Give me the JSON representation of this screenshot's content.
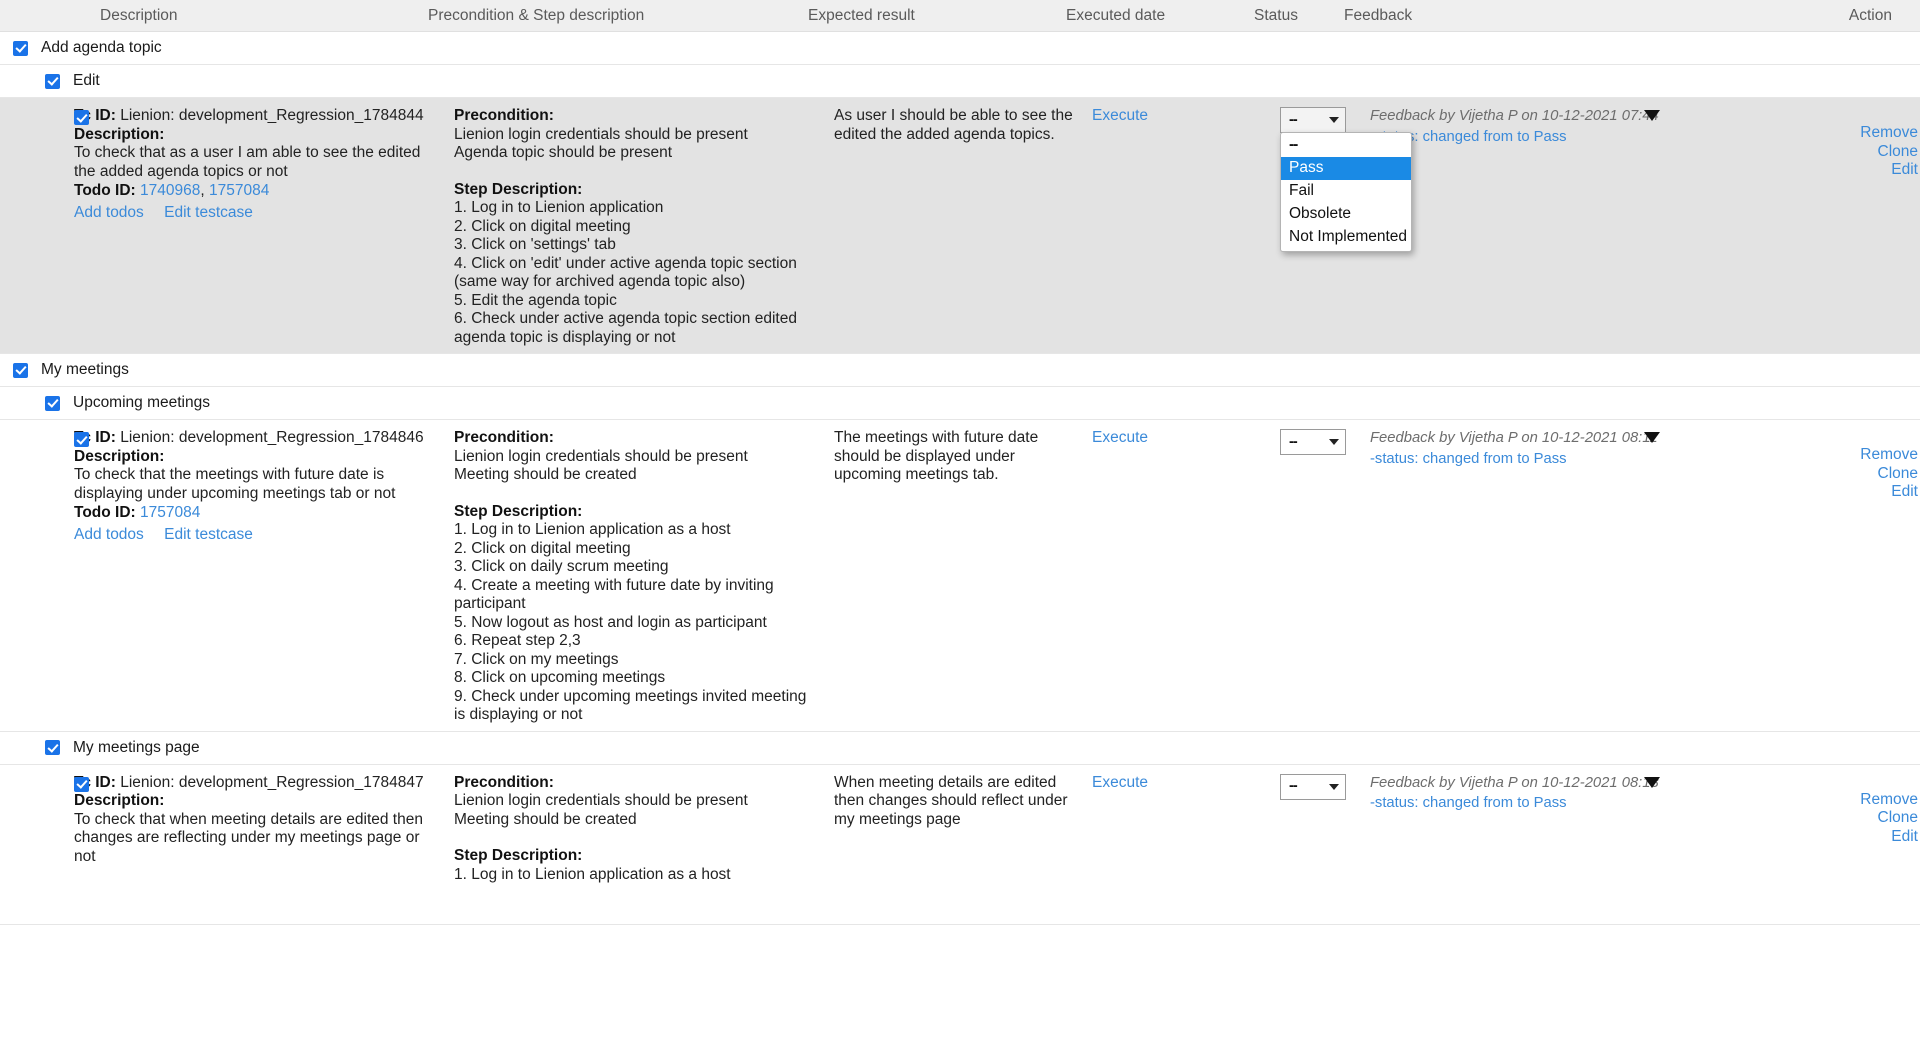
{
  "table": {
    "columns": [
      {
        "key": "checkbox",
        "label": ""
      },
      {
        "key": "description",
        "label": "Description"
      },
      {
        "key": "step",
        "label": "Precondition & Step description"
      },
      {
        "key": "expected",
        "label": "Expected result"
      },
      {
        "key": "executed",
        "label": "Executed date"
      },
      {
        "key": "status",
        "label": "Status"
      },
      {
        "key": "feedback",
        "label": "Feedback"
      },
      {
        "key": "action",
        "label": "Action"
      }
    ]
  },
  "labels": {
    "tc_id": "Tc ID:",
    "description": "Description:",
    "todo_id": "Todo ID:",
    "precondition": "Precondition:",
    "step_description": "Step Description:",
    "add_todos": "Add todos",
    "edit_testcase": "Edit testcase",
    "execute": "Execute",
    "remove": "Remove",
    "clone": "Clone",
    "edit": "Edit",
    "select_placeholder": "--"
  },
  "status_options": [
    "--",
    "Pass",
    "Fail",
    "Obsolete",
    "Not Implemented"
  ],
  "open_dropdown": {
    "row_index": 0,
    "highlighted": "Pass",
    "selected_value": "--"
  },
  "colors": {
    "accent_link": "#3b8ad9",
    "checkbox_blue": "#1a73e8",
    "highlight_blue": "#1a8ae5",
    "row_shaded": "#e3e3e3",
    "header_bg": "#efefef"
  },
  "groups": [
    {
      "label": "Add agenda topic",
      "level": 1,
      "checked": true
    },
    {
      "label": "Edit",
      "level": 2,
      "checked": true
    },
    {
      "label": "My meetings",
      "level": 1,
      "checked": true
    },
    {
      "label": "Upcoming meetings",
      "level": 2,
      "checked": true
    },
    {
      "label": "My meetings page",
      "level": 2,
      "checked": true
    }
  ],
  "rows": [
    {
      "checked": true,
      "shaded": true,
      "tc_id_value": "Lienion: development_Regression_1784844",
      "description": "To check that as a user I am able to see the edited the added agenda topics or not",
      "todo_ids": [
        "1740968",
        "1757084"
      ],
      "precondition": [
        "Lienion login credentials should be present",
        "Agenda topic should be present"
      ],
      "steps": [
        "1. Log in to Lienion application",
        "2. Click on digital meeting",
        "3. Click on 'settings' tab",
        "4. Click on 'edit' under active agenda topic section (same way for archived agenda topic also)",
        "5. Edit the agenda topic",
        "6. Check under active agenda topic section edited agenda topic is displaying or not"
      ],
      "expected_result": "As user I should be able to see the edited the added agenda topics.",
      "executed_date": "",
      "status_value": "--",
      "feedback_author_line": "Feedback by Vijetha P on 10-12-2021 07:44",
      "feedback_status_line": "-status: changed from to Pass"
    },
    {
      "checked": true,
      "shaded": false,
      "tc_id_value": "Lienion: development_Regression_1784846",
      "description": "To check that the meetings with future date is displaying under upcoming meetings tab or not",
      "todo_ids": [
        "1757084"
      ],
      "precondition": [
        "Lienion login credentials should be present",
        "Meeting should be created"
      ],
      "steps": [
        "1. Log in to Lienion application as a host",
        "2. Click on digital meeting",
        "3. Click on daily scrum meeting",
        "4. Create a meeting with future date by inviting participant",
        "5. Now logout as host and login as participant",
        "6. Repeat step 2,3",
        "7. Click on my meetings",
        "8. Click on upcoming meetings",
        "9. Check under upcoming meetings invited meeting is displaying or not"
      ],
      "expected_result": "The meetings with future date should be displayed under upcoming meetings tab.",
      "executed_date": "",
      "status_value": "--",
      "feedback_author_line": "Feedback by Vijetha P on 10-12-2021 08:11",
      "feedback_status_line": "-status: changed from to Pass"
    },
    {
      "checked": true,
      "shaded": false,
      "tc_id_value": "Lienion: development_Regression_1784847",
      "description": "To check that when meeting details are edited then changes are reflecting under my meetings page or not",
      "todo_ids": [],
      "precondition": [
        "Lienion login credentials should be present",
        "Meeting should be created"
      ],
      "steps": [
        "1. Log in to Lienion application as a host"
      ],
      "expected_result": "When meeting details are edited then changes should reflect under my meetings page",
      "executed_date": "",
      "status_value": "--",
      "feedback_author_line": "Feedback by Vijetha P on 10-12-2021 08:13",
      "feedback_status_line": "-status: changed from to Pass"
    }
  ]
}
